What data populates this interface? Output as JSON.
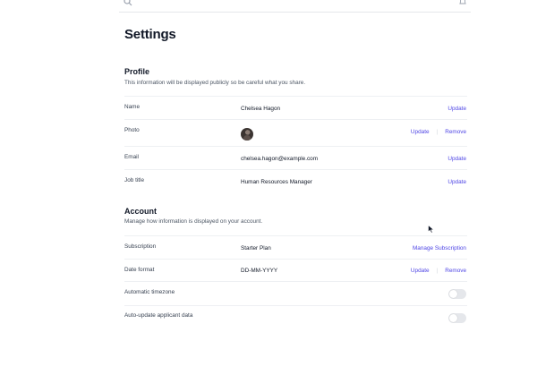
{
  "page": {
    "title": "Settings"
  },
  "profile": {
    "title": "Profile",
    "description": "This information will be displayed publicly so be careful what you share.",
    "rows": [
      {
        "label": "Name",
        "value": "Chelsea Hagon",
        "action": "Update"
      },
      {
        "label": "Photo",
        "action": "Update",
        "secondary_action": "Remove"
      },
      {
        "label": "Email",
        "value": "chelsea.hagon@example.com",
        "action": "Update"
      },
      {
        "label": "Job title",
        "value": "Human Resources Manager",
        "action": "Update"
      }
    ]
  },
  "account": {
    "title": "Account",
    "description": "Manage how information is displayed on your account.",
    "rows": [
      {
        "label": "Subscription",
        "value": "Starter Plan",
        "action": "Manage Subscription"
      },
      {
        "label": "Date format",
        "value": "DD-MM-YYYY",
        "action": "Update",
        "secondary_action": "Remove"
      },
      {
        "label": "Automatic timezone",
        "toggle": false
      },
      {
        "label": "Auto-update applicant data",
        "toggle": false
      }
    ]
  },
  "icons": {
    "search": "search-icon",
    "notifications": "bell-icon",
    "cursor": "mouse-cursor-icon"
  },
  "colors": {
    "accent": "#4f46e5",
    "toggle_off": "#e5e7eb",
    "divider": "#eef0f3"
  }
}
